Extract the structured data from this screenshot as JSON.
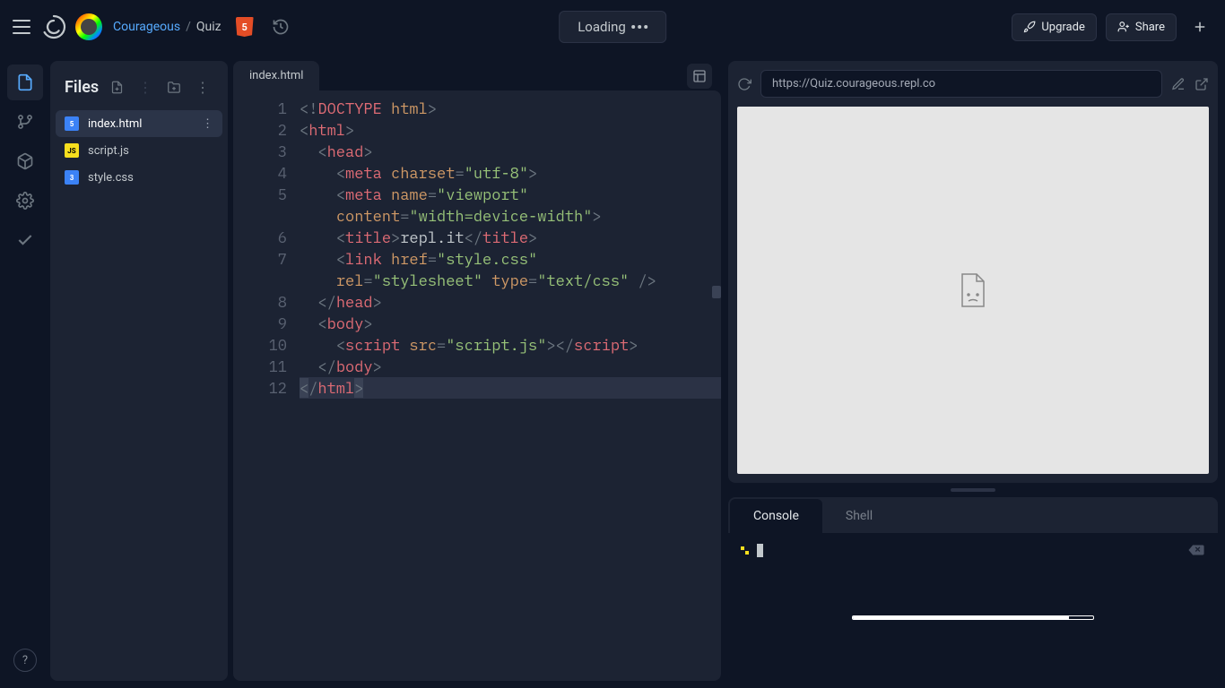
{
  "header": {
    "user": "Courageous",
    "separator": "/",
    "project": "Quiz",
    "loading_label": "Loading",
    "upgrade_label": "Upgrade",
    "share_label": "Share"
  },
  "files_panel": {
    "title": "Files",
    "items": [
      {
        "name": "index.html",
        "icon": "html",
        "active": true
      },
      {
        "name": "script.js",
        "icon": "js",
        "active": false
      },
      {
        "name": "style.css",
        "icon": "css",
        "active": false
      }
    ]
  },
  "editor": {
    "tab": "index.html",
    "lines": [
      {
        "n": 1,
        "wrap": false
      },
      {
        "n": 2,
        "wrap": false
      },
      {
        "n": 3,
        "wrap": false
      },
      {
        "n": 4,
        "wrap": false
      },
      {
        "n": 5,
        "wrap": true
      },
      {
        "n": 6,
        "wrap": false
      },
      {
        "n": 7,
        "wrap": true
      },
      {
        "n": 8,
        "wrap": false
      },
      {
        "n": 9,
        "wrap": false
      },
      {
        "n": 10,
        "wrap": false
      },
      {
        "n": 11,
        "wrap": false
      },
      {
        "n": 12,
        "wrap": false
      }
    ],
    "code": {
      "l1_doctype": "<!DOCTYPE html>",
      "l2": "<html>",
      "l3": "  <head>",
      "l4": "    <meta charset=\"utf-8\">",
      "l5": "    <meta name=\"viewport\" content=\"width=device-width\">",
      "l6": "    <title>repl.it</title>",
      "l7": "    <link href=\"style.css\" rel=\"stylesheet\" type=\"text/css\" />",
      "l8": "  </head>",
      "l9": "  <body>",
      "l10": "    <script src=\"script.js\"></script>",
      "l11": "  </body>",
      "l12": "</html>"
    }
  },
  "preview": {
    "url": "https://Quiz.courageous.repl.co"
  },
  "console": {
    "tabs": [
      {
        "label": "Console",
        "active": true
      },
      {
        "label": "Shell",
        "active": false
      }
    ],
    "progress_percent": 90
  },
  "help_label": "?"
}
